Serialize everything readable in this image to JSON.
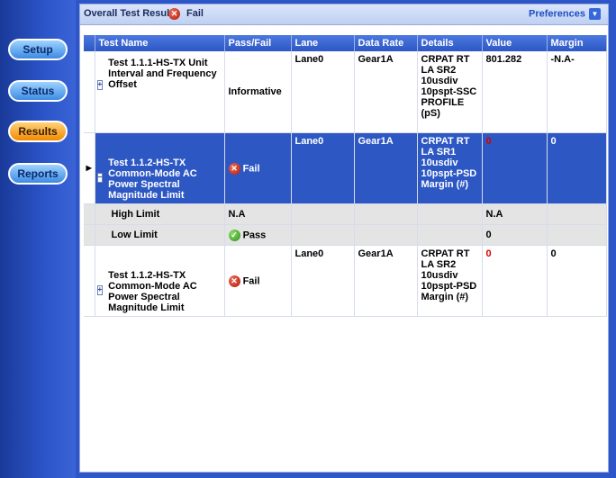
{
  "sidebar": {
    "buttons": [
      {
        "label": "Setup",
        "active": false
      },
      {
        "label": "Status",
        "active": false
      },
      {
        "label": "Results",
        "active": true
      },
      {
        "label": "Reports",
        "active": false
      }
    ]
  },
  "header": {
    "overall_label": "Overall Test Result :",
    "overall_value": "Fail",
    "preferences_label": "Preferences"
  },
  "table": {
    "columns": [
      "Test Name",
      "Pass/Fail",
      "Lane",
      "Data Rate",
      "Details",
      "Value",
      "Margin"
    ],
    "rows": [
      {
        "name": "Test 1.1.1-HS-TX Unit Interval and Frequency Offset",
        "pass_fail": "Informative",
        "lane": "Lane0",
        "data_rate": "Gear1A",
        "details": "CRPAT RT LA SR2 10usdiv 10pspt-SSC PROFILE (pS)",
        "value": "801.282",
        "margin": "-N.A-"
      },
      {
        "name": "Test 1.1.2-HS-TX Common-Mode AC Power Spectral Magnitude Limit",
        "pass_fail": "Fail",
        "lane": "Lane0",
        "data_rate": "Gear1A",
        "details": "CRPAT RT LA SR1 10usdiv 10pspt-PSD Margin (#)",
        "value": "0",
        "margin": "0"
      },
      {
        "name": "Test 1.1.2-HS-TX Common-Mode AC Power Spectral Magnitude Limit",
        "pass_fail": "Fail",
        "lane": "Lane0",
        "data_rate": "Gear1A",
        "details": "CRPAT RT LA SR2 10usdiv 10pspt-PSD Margin (#)",
        "value": "0",
        "margin": "0"
      }
    ],
    "subrows": [
      {
        "label": "High Limit",
        "pass_fail": "N.A",
        "value": "N.A"
      },
      {
        "label": "Low Limit",
        "pass_fail": "Pass",
        "value": "0"
      }
    ]
  },
  "icons": {
    "fail": "x-circle-icon",
    "pass": "check-circle-icon",
    "expand": "plus-box-icon",
    "collapse": "minus-box-icon",
    "row_pointer": "triangle-right-icon",
    "dropdown": "chevron-down-icon"
  },
  "colors": {
    "sidebar": "#2c55c9",
    "header": "#2d58c4",
    "selected_row": "#2d58c4",
    "active_nav": "#f08a00",
    "fail_red": "#d80000",
    "pass_green": "#2f8b14"
  }
}
